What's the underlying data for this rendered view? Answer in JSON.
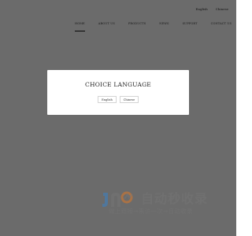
{
  "lang_bar": {
    "english": "English",
    "chinese": "Chinese"
  },
  "nav": {
    "items": [
      {
        "label": "HOME"
      },
      {
        "label": "ABOUT US"
      },
      {
        "label": "PRODUCTS"
      },
      {
        "label": "NEWS"
      },
      {
        "label": "SUPPORT"
      },
      {
        "label": "CONTACT US"
      }
    ],
    "active_index": 0
  },
  "modal": {
    "title": "CHOICE LANGUAGE",
    "english_button": "English",
    "chinese_button": "Chinese"
  },
  "watermark": {
    "main": "自动秒收录",
    "sub": "做上链接→来访一次→自动收录",
    "color": "#7a7a7a"
  },
  "colors": {
    "overlay": "rgba(0,0,0,0.58)",
    "modal_bg": "#ffffff",
    "logo_accent": "#3b82c4"
  }
}
